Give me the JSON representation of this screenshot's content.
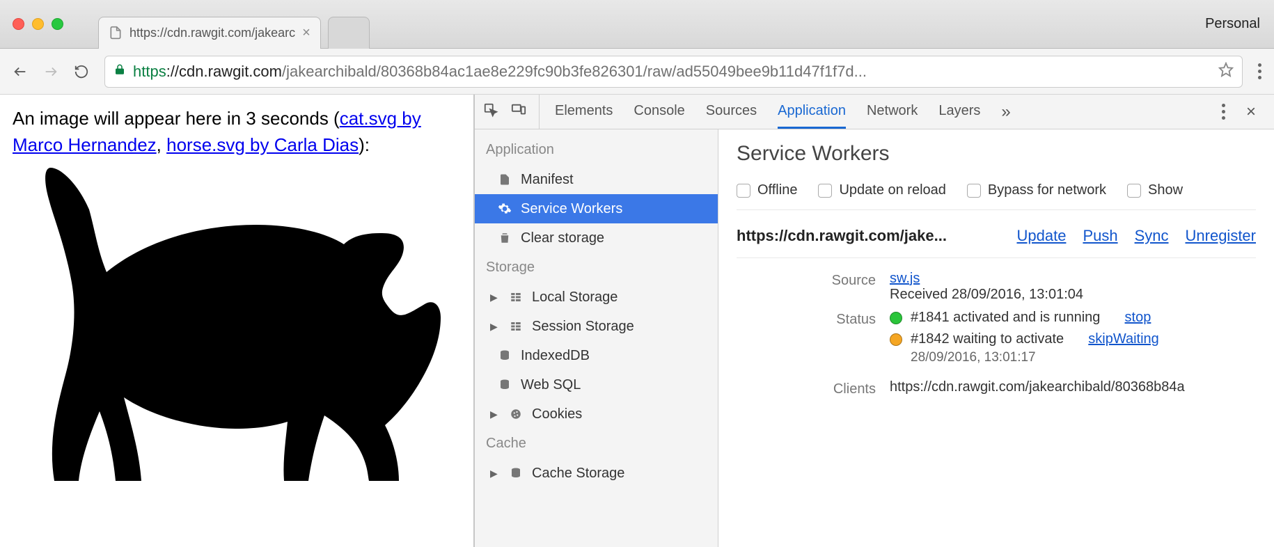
{
  "window": {
    "profile_label": "Personal",
    "tab_title": "https://cdn.rawgit.com/jakearc"
  },
  "toolbar": {
    "url_scheme": "https",
    "url_host": "://cdn.rawgit.com",
    "url_path": "/jakearchibald/80368b84ac1ae8e229fc90b3fe826301/raw/ad55049bee9b11d47f1f7d..."
  },
  "page": {
    "intro_prefix": "An image will appear here in 3 seconds (",
    "link1": "cat.svg by Marco Hernandez",
    "mid": ", ",
    "link2": "horse.svg by Carla Dias",
    "suffix": "):"
  },
  "devtools": {
    "tabs": [
      "Elements",
      "Console",
      "Sources",
      "Application",
      "Network",
      "Layers"
    ],
    "active_tab": "Application",
    "sidebar": {
      "sections": [
        {
          "title": "Application",
          "items": [
            "Manifest",
            "Service Workers",
            "Clear storage"
          ]
        },
        {
          "title": "Storage",
          "items": [
            "Local Storage",
            "Session Storage",
            "IndexedDB",
            "Web SQL",
            "Cookies"
          ]
        },
        {
          "title": "Cache",
          "items": [
            "Cache Storage"
          ]
        }
      ],
      "selected": "Service Workers"
    },
    "panel": {
      "title": "Service Workers",
      "checks": [
        "Offline",
        "Update on reload",
        "Bypass for network",
        "Show"
      ],
      "scope": "https://cdn.rawgit.com/jake...",
      "actions": [
        "Update",
        "Push",
        "Sync",
        "Unregister"
      ],
      "source_label": "Source",
      "source_link": "sw.js",
      "source_received": "Received 28/09/2016, 13:01:04",
      "status_label": "Status",
      "status1_text": "#1841 activated and is running",
      "status1_action": "stop",
      "status2_text": "#1842 waiting to activate",
      "status2_action": "skipWaiting",
      "status2_time": "28/09/2016, 13:01:17",
      "clients_label": "Clients",
      "clients_value": "https://cdn.rawgit.com/jakearchibald/80368b84a"
    }
  }
}
